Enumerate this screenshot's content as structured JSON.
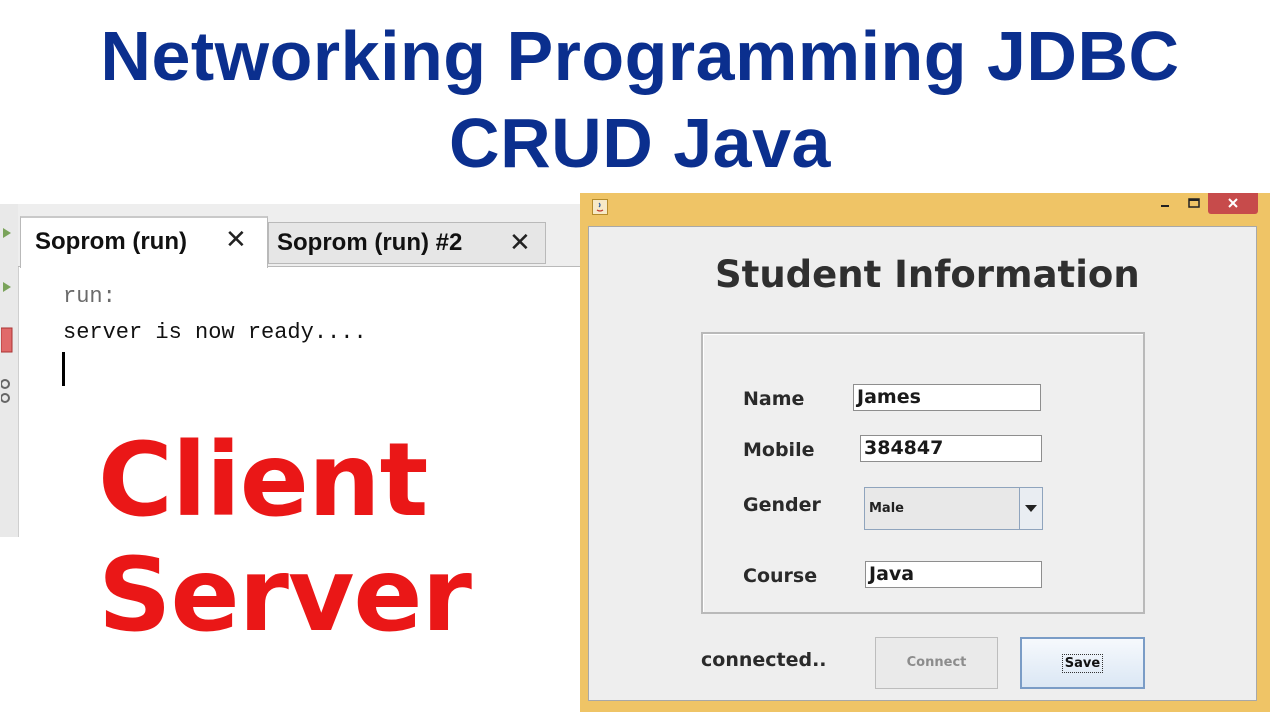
{
  "title": {
    "line1": "Networking Programming JDBC",
    "line2": "CRUD Java"
  },
  "ide": {
    "tabs": [
      {
        "label": "Soprom (run)",
        "close": "✕"
      },
      {
        "label": "Soprom (run) #2",
        "close": "✕"
      }
    ],
    "console": {
      "line1": "run:",
      "line2": "server is now ready...."
    }
  },
  "overlay": {
    "word1": "Client",
    "word2": "Server"
  },
  "window": {
    "controls": {
      "minimize": "‒",
      "maximize": "☐",
      "close": "✕"
    },
    "form_title": "Student Information",
    "fields": {
      "name_label": "Name",
      "name_value": "James",
      "mobile_label": "Mobile",
      "mobile_value": "384847",
      "gender_label": "Gender",
      "gender_value": "Male",
      "course_label": "Course",
      "course_value": "Java"
    },
    "status": "connected..",
    "buttons": {
      "connect": "Connect",
      "save": "Save"
    }
  },
  "colors": {
    "title_blue": "#0b2f8e",
    "overlay_red": "#ea1717",
    "window_frame": "#efc466",
    "close_red": "#c74b4b"
  }
}
